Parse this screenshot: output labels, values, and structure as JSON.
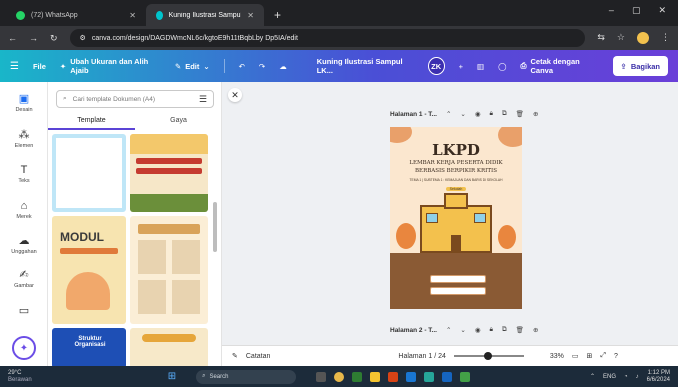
{
  "browser": {
    "tabs": [
      {
        "label": "(72) WhatsApp",
        "favicon_color": "#25d366"
      },
      {
        "label": "Kuning Ilustrasi Sampul LKPD –",
        "favicon_color": "#00c4cc"
      }
    ],
    "new_tab": "+",
    "url": "canva.com/design/DAGDWmcNL6c/kgtoE9h11tBqbLby Dp5IA/edit"
  },
  "canva": {
    "menu": "File",
    "resize": "Ubah Ukuran dan Alih Ajaib",
    "edit": "Edit",
    "doc_title": "Kuning Ilustrasi Sampul LK...",
    "avatar": "ZK",
    "print": "Cetak dengan Canva",
    "share": "Bagikan"
  },
  "rail": [
    {
      "label": "Desain",
      "icon": "design-icon"
    },
    {
      "label": "Elemen",
      "icon": "elements-icon"
    },
    {
      "label": "Teks",
      "icon": "text-icon"
    },
    {
      "label": "Merek",
      "icon": "brand-icon"
    },
    {
      "label": "Unggahan",
      "icon": "upload-icon"
    },
    {
      "label": "Gambar",
      "icon": "draw-icon"
    },
    {
      "label": "",
      "icon": "projects-icon"
    }
  ],
  "panel": {
    "search_placeholder": "Cari template Dokumen (A4)",
    "tabs": [
      "Template",
      "Gaya"
    ],
    "thumb_texts": [
      "MODUL",
      "Struktur Organisasi"
    ]
  },
  "workspace": {
    "page1_label": "Halaman 1 - T...",
    "page2_label": "Halaman 2 - T...",
    "cover_title": "LKPD",
    "cover_sub1": "LEMBAR KERJA PESERTA DIDIK",
    "cover_sub2": "BERBASIS BERPIKIR KRITIS",
    "cover_theme": "TEMA 1 | SUBTEMA 1 : KEMAJUAN DAN BARIS DI SEKOLAH",
    "cover_school": "Sekolah"
  },
  "bottom": {
    "notes": "Catatan",
    "page_indicator": "Halaman 1 / 24",
    "zoom": "33%"
  },
  "taskbar": {
    "weather": "29°C",
    "weather_sub": "Berawan",
    "search": "Search",
    "lang": "ENG",
    "time": "1:12 PM",
    "date": "6/6/2024"
  }
}
